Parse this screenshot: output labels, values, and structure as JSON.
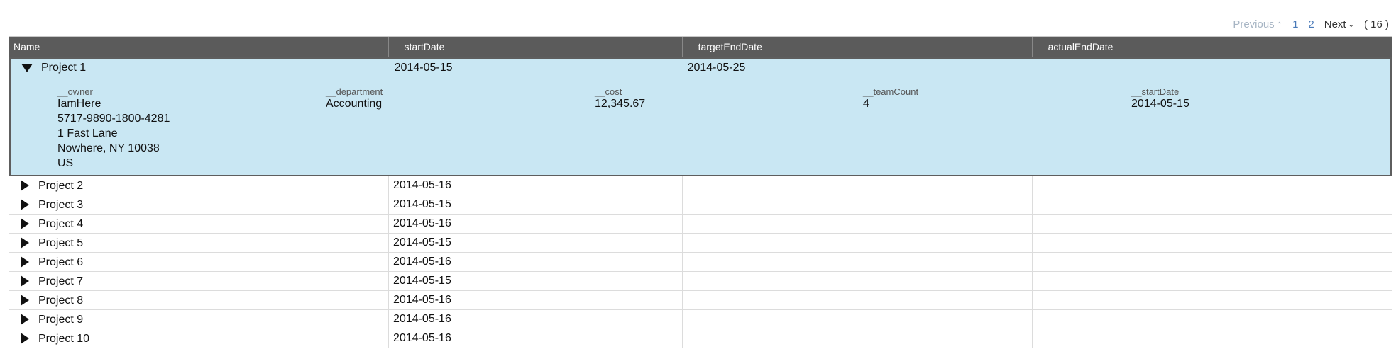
{
  "pager": {
    "previous": "Previous",
    "pages": [
      "1",
      "2"
    ],
    "next": "Next",
    "total": "( 16 )"
  },
  "columns": [
    "Name",
    "__startDate",
    "__targetEndDate",
    "__actualEndDate"
  ],
  "expanded_row": {
    "name": "Project 1",
    "startDate": "2014-05-15",
    "targetEndDate": "2014-05-25",
    "actualEndDate": "",
    "detail": {
      "owner_label": "__owner",
      "owner_lines": [
        "IamHere",
        "5717-9890-1800-4281",
        "1 Fast Lane",
        "Nowhere, NY 10038",
        "US"
      ],
      "department_label": "__department",
      "department": "Accounting",
      "cost_label": "__cost",
      "cost": "12,345.67",
      "teamCount_label": "__teamCount",
      "teamCount": "4",
      "startDate_label": "__startDate",
      "startDate": "2014-05-15"
    }
  },
  "rows": [
    {
      "name": "Project 2",
      "startDate": "2014-05-16",
      "targetEndDate": "",
      "actualEndDate": ""
    },
    {
      "name": "Project 3",
      "startDate": "2014-05-15",
      "targetEndDate": "",
      "actualEndDate": ""
    },
    {
      "name": "Project 4",
      "startDate": "2014-05-16",
      "targetEndDate": "",
      "actualEndDate": ""
    },
    {
      "name": "Project 5",
      "startDate": "2014-05-15",
      "targetEndDate": "",
      "actualEndDate": ""
    },
    {
      "name": "Project 6",
      "startDate": "2014-05-16",
      "targetEndDate": "",
      "actualEndDate": ""
    },
    {
      "name": "Project 7",
      "startDate": "2014-05-15",
      "targetEndDate": "",
      "actualEndDate": ""
    },
    {
      "name": "Project 8",
      "startDate": "2014-05-16",
      "targetEndDate": "",
      "actualEndDate": ""
    },
    {
      "name": "Project 9",
      "startDate": "2014-05-16",
      "targetEndDate": "",
      "actualEndDate": ""
    },
    {
      "name": "Project 10",
      "startDate": "2014-05-16",
      "targetEndDate": "",
      "actualEndDate": ""
    }
  ]
}
